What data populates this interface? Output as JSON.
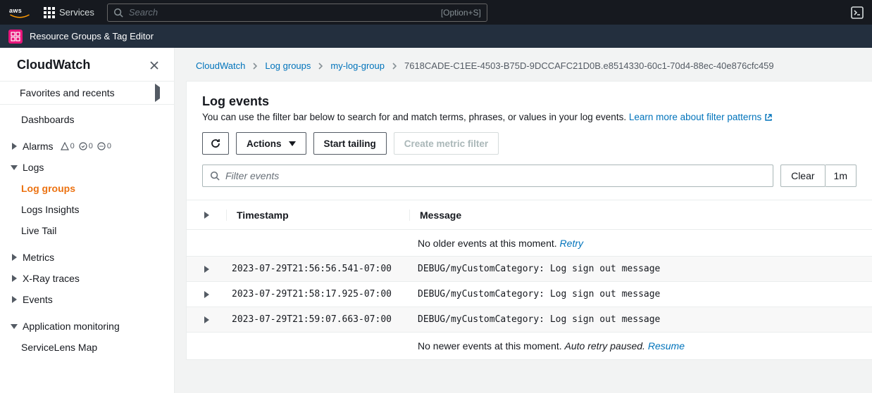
{
  "topbar": {
    "services_label": "Services",
    "search_placeholder": "Search",
    "search_shortcut": "[Option+S]"
  },
  "subbar": {
    "label": "Resource Groups & Tag Editor"
  },
  "sidebar": {
    "title": "CloudWatch",
    "favorites_label": "Favorites and recents",
    "items": [
      {
        "label": "Dashboards",
        "indent": true,
        "caret": "none"
      },
      {
        "label": "Alarms",
        "caret": "right",
        "badges": true,
        "badge_a": "0",
        "badge_b": "0",
        "badge_c": "0"
      },
      {
        "label": "Logs",
        "caret": "down"
      },
      {
        "label": "Log groups",
        "indent": true,
        "caret": "none",
        "selected": true
      },
      {
        "label": "Logs Insights",
        "indent": true,
        "caret": "none"
      },
      {
        "label": "Live Tail",
        "indent": true,
        "caret": "none"
      },
      {
        "label": "Metrics",
        "caret": "right"
      },
      {
        "label": "X-Ray traces",
        "caret": "right"
      },
      {
        "label": "Events",
        "caret": "right"
      },
      {
        "label": "Application monitoring",
        "caret": "down"
      },
      {
        "label": "ServiceLens Map",
        "indent": true,
        "caret": "none"
      }
    ]
  },
  "breadcrumb": {
    "items": [
      {
        "label": "CloudWatch",
        "link": true
      },
      {
        "label": "Log groups",
        "link": true
      },
      {
        "label": "my-log-group",
        "link": true
      },
      {
        "label": "7618CADE-C1EE-4503-B75D-9DCCAFC21D0B.e8514330-60c1-70d4-88ec-40e876cfc459",
        "link": false
      }
    ]
  },
  "panel": {
    "heading": "Log events",
    "description": "You can use the filter bar below to search for and match terms, phrases, or values in your log events.",
    "learn_more": "Learn more about filter patterns",
    "actions_label": "Actions",
    "start_tailing_label": "Start tailing",
    "create_metric_label": "Create metric filter",
    "filter_placeholder": "Filter events",
    "clear_label": "Clear",
    "range_label": "1m"
  },
  "table": {
    "col_timestamp": "Timestamp",
    "col_message": "Message",
    "no_older": "No older events at this moment.",
    "retry": "Retry",
    "no_newer": "No newer events at this moment.",
    "auto_paused": "Auto retry paused.",
    "resume": "Resume",
    "rows": [
      {
        "ts": "2023-07-29T21:56:56.541-07:00",
        "msg": "DEBUG/myCustomCategory: Log sign out message"
      },
      {
        "ts": "2023-07-29T21:58:17.925-07:00",
        "msg": "DEBUG/myCustomCategory: Log sign out message"
      },
      {
        "ts": "2023-07-29T21:59:07.663-07:00",
        "msg": "DEBUG/myCustomCategory: Log sign out message"
      }
    ]
  }
}
